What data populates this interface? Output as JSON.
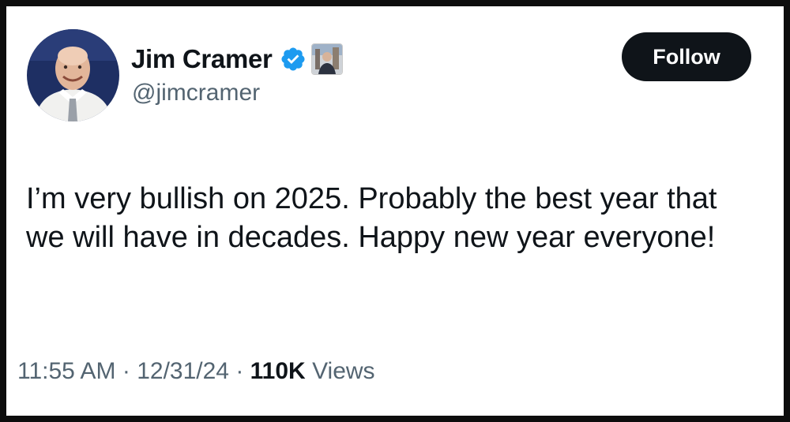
{
  "author": {
    "display_name": "Jim Cramer",
    "handle": "@jimcramer",
    "verified_icon": "verified-badge-icon",
    "affiliate_icon": "affiliate-image-icon",
    "avatar_icon": "profile-photo"
  },
  "follow_button": {
    "label": "Follow"
  },
  "tweet": {
    "text": "I’m very bullish on 2025. Probably the best year that we will have in decades. Happy new year everyone!"
  },
  "meta": {
    "time": "11:55 AM",
    "separator": " · ",
    "date": "12/31/24",
    "views_count": "110K",
    "views_label": "Views"
  },
  "colors": {
    "text_primary": "#0f1419",
    "text_secondary": "#536471",
    "verified_blue": "#1d9bf0",
    "button_bg": "#0f1419",
    "background": "#ffffff"
  }
}
